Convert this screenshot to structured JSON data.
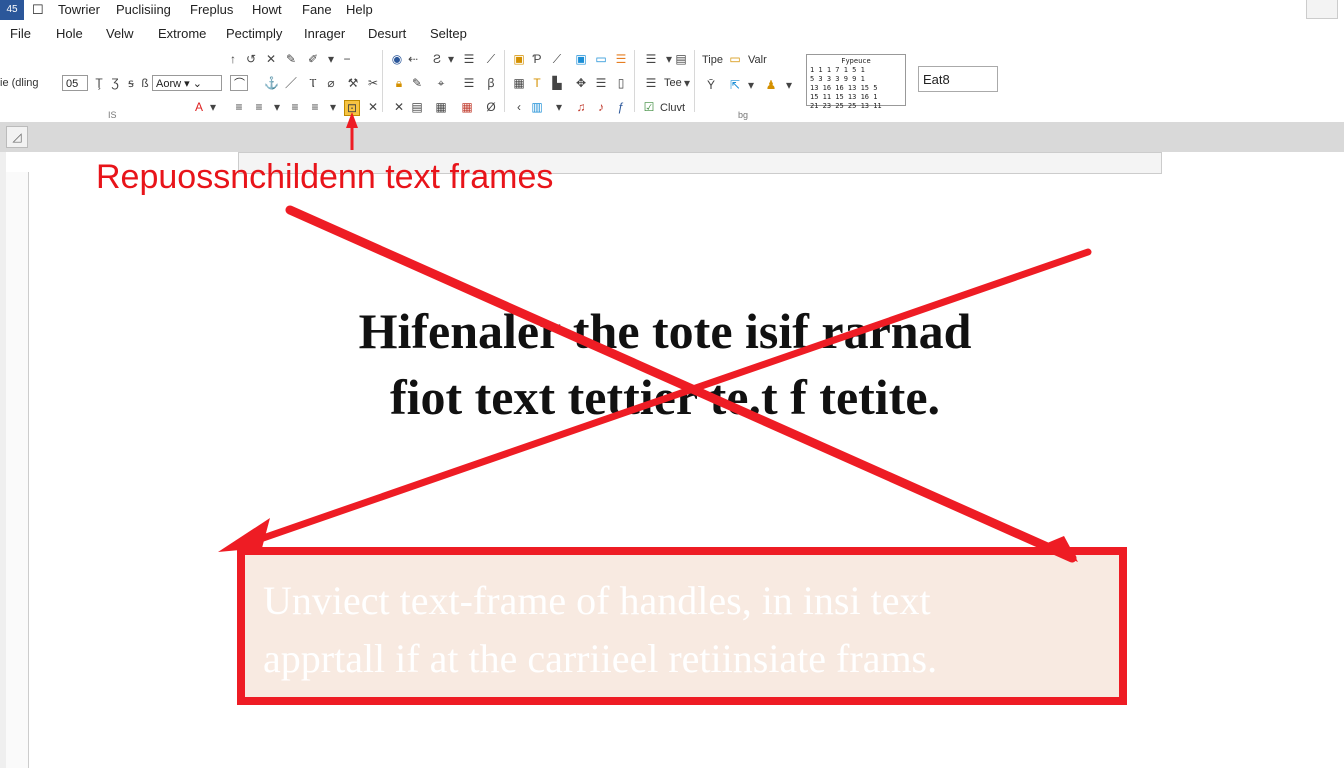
{
  "titlebar": {
    "app_icon": "45",
    "menu": [
      "Towrier",
      "Puclisiing",
      "Freplus",
      "Howt",
      "Fane",
      "Help"
    ]
  },
  "menubar": [
    "File",
    "Hole",
    "Velw",
    "Extrome",
    "Pectimply",
    "Inrager",
    "Desurt",
    "Seltep"
  ],
  "ribbon": {
    "left_label": "ie (dling",
    "font_size": "05",
    "font_name": "Aorw",
    "group1_label": "IS",
    "group2_label": "bg",
    "row1_right_a": "Tipe",
    "row1_right_b": "Valr",
    "row2_right": "Tee",
    "row3_right": "Cluvt",
    "calendar_title": "Fypeuce",
    "calendar_rows": [
      "1 1 1 7 1 5 1",
      "5 3 3 3 9 9 1",
      "13 16 16 13 15 5",
      "15 11 15 13 16 1",
      "21 23 25 25 13 11"
    ],
    "name_box": "Eat8"
  },
  "document": {
    "callout_title": "Repuossnchildenn text frames",
    "main_line1": "Hifenaler the tote  isif  rarnad",
    "main_line2": "fiot text tettier  te.t  f  tetite.",
    "frame_line1": "Unviect text-frame of handles, in insi text",
    "frame_line2": "apprtall if at the carriieel retiinsiate frams."
  },
  "colors": {
    "annotation_red": "#ee1c24",
    "app_blue": "#2b579a",
    "frame_fill": "#f8eae1"
  }
}
